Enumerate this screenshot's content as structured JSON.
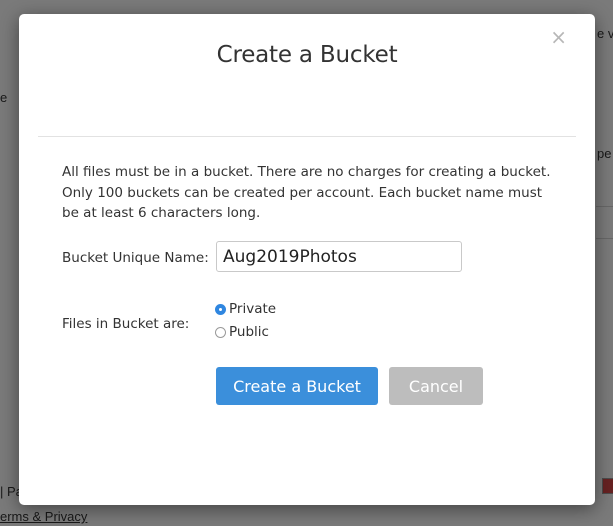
{
  "background": {
    "fragments": {
      "top_right": "e v",
      "left_mid": "e",
      "right_mid": "pe",
      "bottom_left": "| Pa",
      "footer_link": "erms & Privacy"
    }
  },
  "modal": {
    "title": "Create a Bucket",
    "close_label": "×",
    "description": "All files must be in a bucket. There are no charges for creating a bucket. Only 100 buckets can be created per account. Each bucket name must be at least 6 characters long.",
    "name_field": {
      "label": "Bucket Unique Name:",
      "value": "Aug2019Photos"
    },
    "privacy_field": {
      "label": "Files in Bucket are:",
      "options": [
        {
          "label": "Private",
          "selected": true
        },
        {
          "label": "Public",
          "selected": false
        }
      ]
    },
    "buttons": {
      "create_label": "Create a Bucket",
      "cancel_label": "Cancel"
    }
  },
  "colors": {
    "primary": "#3b8fdb",
    "secondary": "#bdbdbd",
    "radio_selected": "#2f86e0"
  }
}
